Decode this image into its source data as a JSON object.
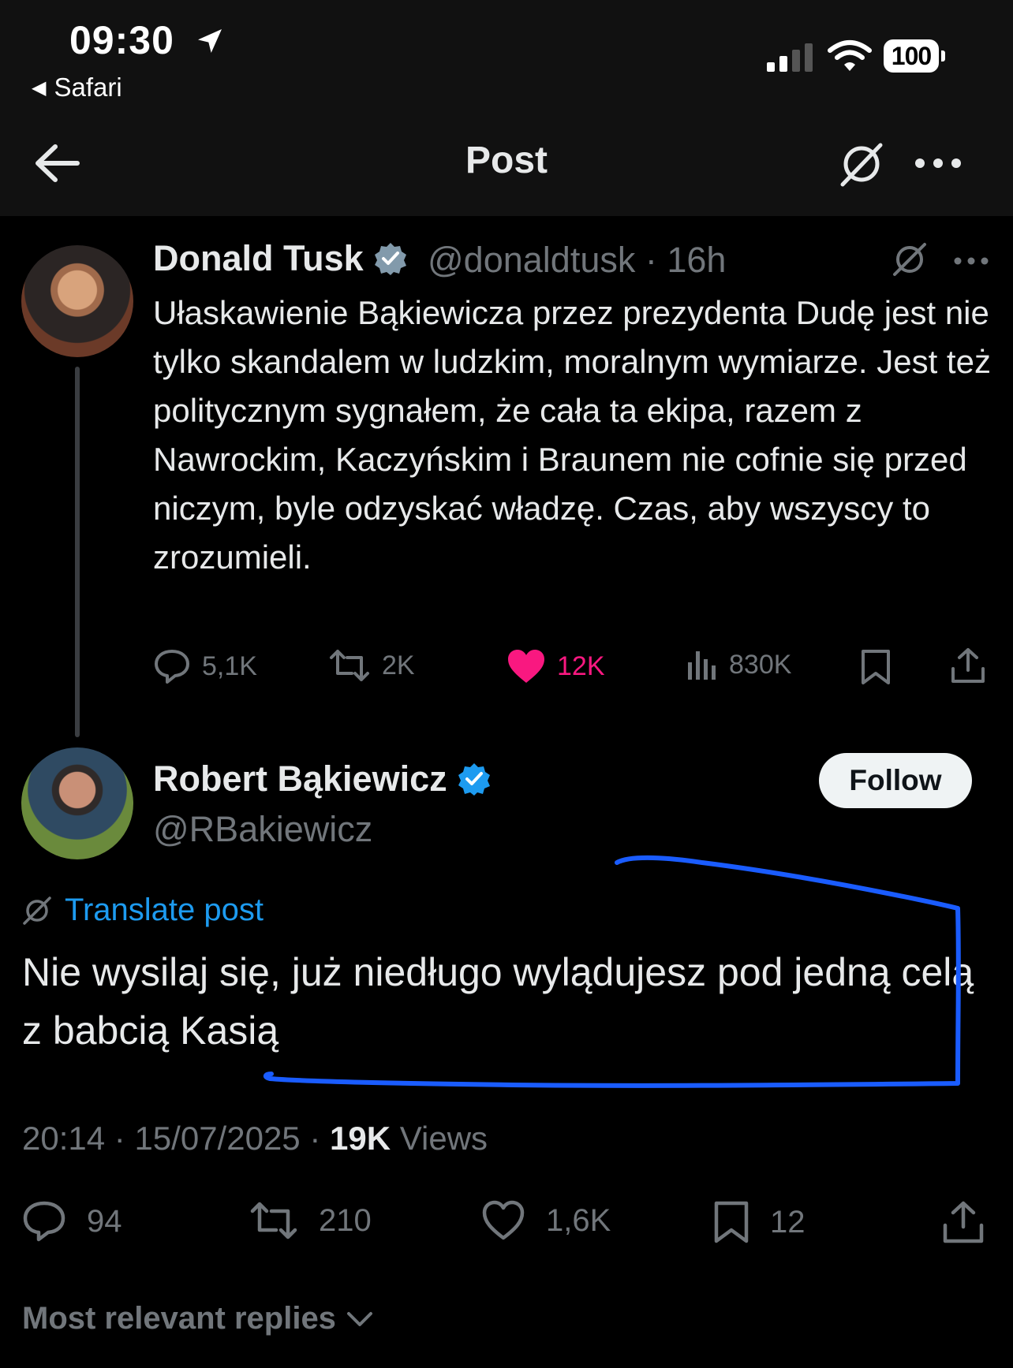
{
  "status_bar": {
    "time": "09:30",
    "back_app": "Safari",
    "battery": "100"
  },
  "nav": {
    "title": "Post"
  },
  "parent_post": {
    "author_name": "Donald Tusk",
    "handle": "@donaldtusk",
    "separator": "·",
    "age": "16h",
    "text": "Ułaskawienie Bąkiewicza przez prezydenta Dudę jest nie tylko skandalem w ludzkim, moralnym wymiarze. Jest też politycznym sygnałem, że cała ta ekipa, razem z Nawrockim, Kaczyńskim i Braunem nie cofnie się przed niczym, byle odzyskać władzę. Czas, aby wszyscy to zrozumieli.",
    "replies": "5,1K",
    "reposts": "2K",
    "likes": "12K",
    "views": "830K"
  },
  "main_post": {
    "author_name": "Robert Bąkiewicz",
    "handle": "@RBakiewicz",
    "follow_label": "Follow",
    "translate_label": "Translate post",
    "text": "Nie wysilaj się, już niedługo wylądujesz pod jedną celą z babcią Kasią",
    "time": "20:14",
    "date": "15/07/2025",
    "views_count": "19K",
    "views_label": "Views",
    "replies": "94",
    "reposts": "210",
    "likes": "1,6K",
    "bookmarks": "12"
  },
  "replies_section": {
    "label": "Most relevant replies"
  },
  "colors": {
    "background": "#000000",
    "accent": "#1d9bf0",
    "like": "#f91880",
    "muted": "#71767b",
    "annotation": "#1a5cff"
  }
}
